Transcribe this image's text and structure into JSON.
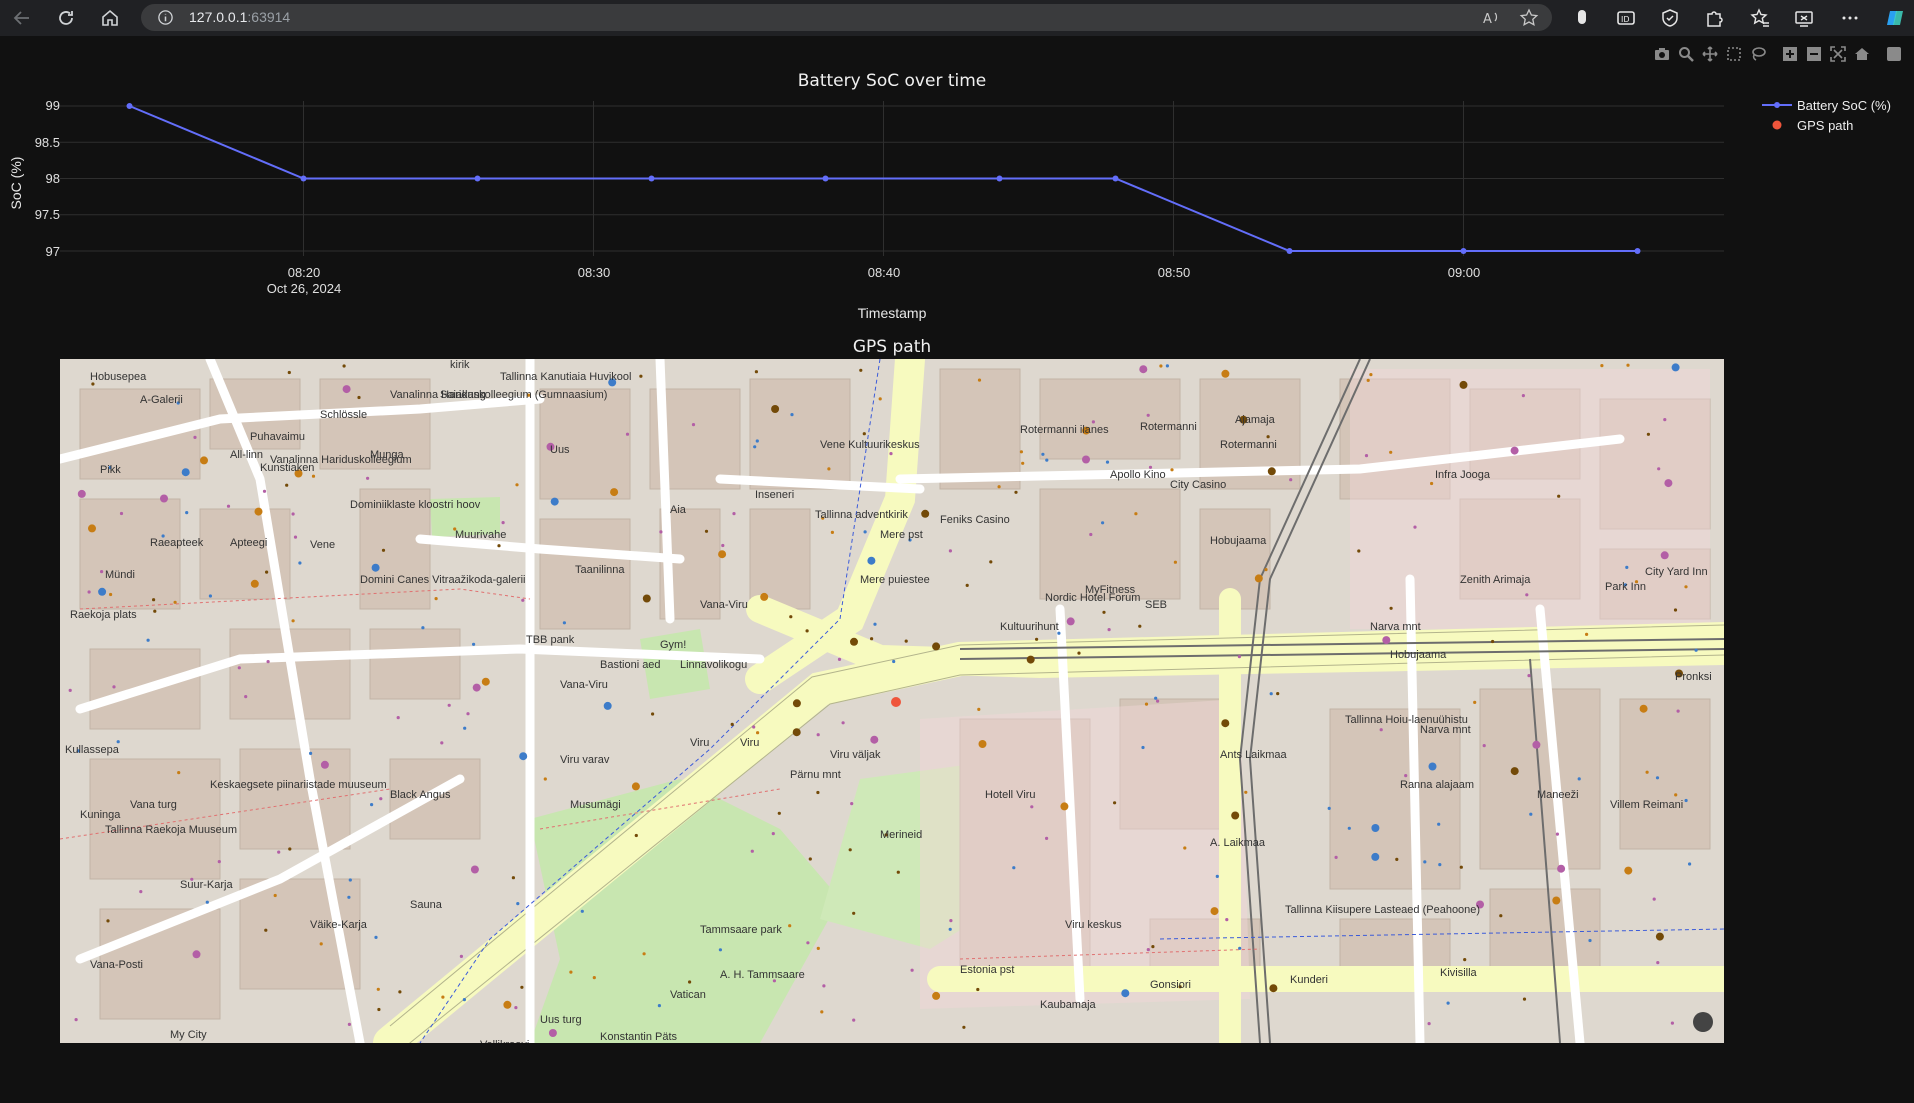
{
  "browser": {
    "url_host": "127.0.0.1",
    "url_port": ":63914",
    "icons": [
      "back-icon",
      "reload-icon",
      "home-icon",
      "info-icon",
      "read-aloud-icon",
      "star-icon",
      "extension-icon",
      "immersive-reader-icon",
      "shield-icon",
      "puzzle-icon",
      "favorites-icon",
      "collections-icon",
      "more-icon",
      "copilot-icon"
    ]
  },
  "modebar": [
    "camera-icon",
    "zoom-icon",
    "pan-icon",
    "box-select-icon",
    "lasso-icon",
    "zoom-in-icon",
    "zoom-out-icon",
    "autoscale-icon",
    "reset-axes-icon",
    "plotly-logo-icon"
  ],
  "chart": {
    "title": "Battery SoC over time",
    "xlabel": "Timestamp",
    "ylabel": "SoC (%)",
    "x_ticks": [
      "08:20",
      "08:30",
      "08:40",
      "08:50",
      "09:00"
    ],
    "x_tick_date": "Oct 26, 2024",
    "y_ticks": [
      "99",
      "98.5",
      "98",
      "97.5",
      "97"
    ]
  },
  "chart_data": {
    "type": "line",
    "title": "Battery SoC over time",
    "xlabel": "Timestamp",
    "ylabel": "SoC (%)",
    "x": [
      "2024-10-26 08:14",
      "2024-10-26 08:20",
      "2024-10-26 08:26",
      "2024-10-26 08:32",
      "2024-10-26 08:38",
      "2024-10-26 08:44",
      "2024-10-26 08:48",
      "2024-10-26 08:54",
      "2024-10-26 09:00",
      "2024-10-26 09:06"
    ],
    "series": [
      {
        "name": "Battery SoC (%)",
        "color": "#636efa",
        "values": [
          99,
          98,
          98,
          98,
          98,
          98,
          98,
          97,
          97,
          97
        ]
      }
    ],
    "ylim": [
      96.9,
      99.1
    ],
    "grid": true,
    "legend_position": "top-right"
  },
  "legend": [
    {
      "label": "Battery SoC (%)",
      "color": "#636efa"
    },
    {
      "label": "GPS path",
      "color": "#ef553b"
    }
  ],
  "map": {
    "title": "GPS path",
    "marker_color": "#ef553b",
    "labels": [
      "Hobusepea",
      "A-Galerii",
      "Schlössle",
      "Puhavaimu",
      "All-linn",
      "Pikk",
      "Munga",
      "Kunstiaken",
      "Dominiiklaste kloostri hoov",
      "Raeapteek",
      "Apteegi",
      "Vene",
      "Mündi",
      "Raekoja plats",
      "Domini Canes Vitraažikoda-galerii",
      "Muurivahe",
      "Uus",
      "Taanilinna",
      "TBB pank",
      "Vana-Viru",
      "Bastioni aed",
      "Gym!",
      "Linnavolikogu",
      "Aia",
      "Vana-Viru",
      "Viru",
      "Viru varav",
      "Musumägi",
      "Tammsaare park",
      "A. H. Tammsaare",
      "Vatican",
      "Uus turg",
      "Konstantin Päts",
      "Tallinna adventkirik",
      "Mere puiestee",
      "Mere pst",
      "Inseneri",
      "Vene Kultuurikeskus",
      "Feniks Casino",
      "Kultuurihunt",
      "Viru väljak",
      "Pärnu mnt",
      "Merineid",
      "Hotell Viru",
      "Viru keskus",
      "Rotermanni ilanes",
      "Rotermanni",
      "Ajamaja",
      "Apollo Kino",
      "City Casino",
      "Nordic Hotel Forum",
      "MyFitness",
      "SEB",
      "Rotermanni",
      "Hobujaama",
      "Narva mnt",
      "Tallinna Hoiu-laenuühistu",
      "A. Laikmaa",
      "Ants Laikmaa",
      "Tallinna Kiisupere Lasteaed (Peahoone)",
      "Ranna alajaam",
      "Estonia pst",
      "Gonsiori",
      "Kaubamaja",
      "Infra Jooga",
      "Zenith Arimaja",
      "Park Inn",
      "City Yard Inn",
      "Pronksi",
      "Maneeži",
      "Villem Reimani",
      "Kivisilla",
      "Kunderi",
      "Vallikraavi",
      "Suur-Karja",
      "Väike-Karja",
      "Kullassepa",
      "Vana turg",
      "Kuninga",
      "Black Angus",
      "Keskaegsete piinariistade muuseum",
      "Tallinna Raekoja Muuseum",
      "Vana-Posti",
      "My City",
      "Saiakang",
      "Tallinna Kanutiaia Huvikool",
      "Vanalinna Hariduskolleegium (Gumnaasium)",
      "Vanalinna Hariduskolleegium",
      "Sauna",
      "kirik",
      "Hobujaama",
      "Narva mnt",
      "Viru"
    ]
  }
}
